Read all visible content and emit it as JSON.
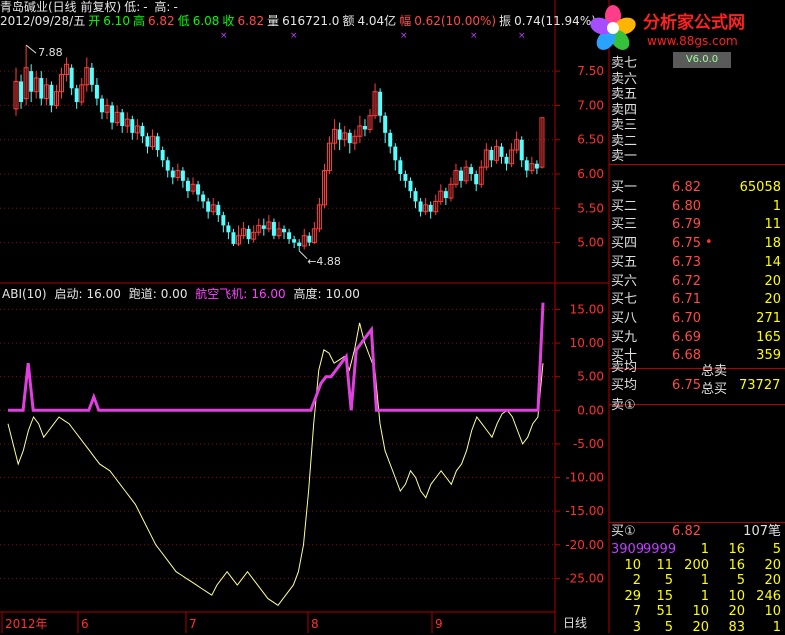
{
  "header": {
    "stock_name": "青岛碱业(日线 前复权)",
    "low_label": "低:",
    "low_val": "-",
    "high_label": "高:",
    "high_val": "-",
    "date_line": "2012/09/28/五",
    "open_label": "开",
    "open_val": "6.10",
    "high2_label": "高",
    "high2_val": "6.82",
    "low2_label": "低",
    "low2_val": "6.08",
    "close_label": "收",
    "close_val": "6.82",
    "volume_label": "量",
    "volume_val": "616721.0",
    "amount_label": "额",
    "amount_val": "4.04亿",
    "change_label": "幅",
    "change_val": "0.62(10.00%)",
    "amp_label": "振",
    "amp_val": "0.74(11.94%)"
  },
  "logo": {
    "text": "分析家公式网",
    "url": "www.88gs.com",
    "version": "V6.0.0"
  },
  "indicator": {
    "name": "ABI(10)",
    "items": [
      {
        "label": "启动:",
        "value": "16.00"
      },
      {
        "label": "跑道:",
        "value": "0.00"
      },
      {
        "label": "航空飞机:",
        "value": "16.00"
      },
      {
        "label": "高度:",
        "value": "10.00"
      }
    ]
  },
  "annotations": {
    "high_mark": "7.88",
    "low_mark": "4.88"
  },
  "x_axis_labels": [
    "2012年",
    "6",
    "7",
    "8",
    "9"
  ],
  "period_label": "日线",
  "order_book": {
    "sell": [
      {
        "label": "卖七",
        "price": "",
        "vol": ""
      },
      {
        "label": "卖六",
        "price": "",
        "vol": ""
      },
      {
        "label": "卖五",
        "price": "",
        "vol": ""
      },
      {
        "label": "卖四",
        "price": "",
        "vol": ""
      },
      {
        "label": "卖三",
        "price": "",
        "vol": ""
      },
      {
        "label": "卖二",
        "price": "",
        "vol": ""
      },
      {
        "label": "卖一",
        "price": "",
        "vol": ""
      }
    ],
    "buy": [
      {
        "label": "买一",
        "price": "6.82",
        "vol": "65058"
      },
      {
        "label": "买二",
        "price": "6.80",
        "vol": "1"
      },
      {
        "label": "买三",
        "price": "6.79",
        "vol": "11"
      },
      {
        "label": "买四",
        "price": "6.75",
        "vol": "18"
      },
      {
        "label": "买五",
        "price": "6.73",
        "vol": "14"
      },
      {
        "label": "买六",
        "price": "6.72",
        "vol": "20"
      },
      {
        "label": "买七",
        "price": "6.71",
        "vol": "20"
      },
      {
        "label": "买八",
        "price": "6.70",
        "vol": "271"
      },
      {
        "label": "买九",
        "price": "6.69",
        "vol": "165"
      },
      {
        "label": "买十",
        "price": "6.68",
        "vol": "359"
      }
    ],
    "sell_avg_label": "卖均",
    "buy_avg_label": "买均",
    "buy_avg_val": "6.75",
    "total_sell_label": "总卖",
    "total_buy_label": "总买",
    "total_buy_val": "73727",
    "sell_circle_label": "卖①",
    "buy_circle_label": "买①",
    "buy_circle_price": "6.82",
    "buy_circle_count": "107笔"
  },
  "queue_rows": [
    [
      "3909",
      "9999",
      "1",
      "16",
      "5"
    ],
    [
      "10",
      "11",
      "200",
      "16",
      "20"
    ],
    [
      "2",
      "5",
      "1",
      "5",
      "20"
    ],
    [
      "29",
      "15",
      "1",
      "10",
      "246"
    ],
    [
      "7",
      "51",
      "10",
      "20",
      "10"
    ],
    [
      "3",
      "5",
      "20",
      "83",
      "1"
    ]
  ],
  "chart_data": [
    {
      "type": "candlestick",
      "title": "",
      "ylim": [
        4.6,
        8.1
      ],
      "y_ticks": [
        5.0,
        5.5,
        6.0,
        6.5,
        7.0,
        7.5
      ],
      "x_ticks": [
        "2012年",
        "6",
        "7",
        "8",
        "9"
      ],
      "annotations": [
        {
          "text": "7.88",
          "at": "max"
        },
        {
          "text": "4.88",
          "at": "min"
        }
      ],
      "candles": [
        [
          6.95,
          7.35,
          7.55,
          6.85
        ],
        [
          7.35,
          7.05,
          7.45,
          6.95
        ],
        [
          7.1,
          7.55,
          7.88,
          7.0
        ],
        [
          7.5,
          7.2,
          7.6,
          7.05
        ],
        [
          7.2,
          7.4,
          7.5,
          7.1
        ],
        [
          7.4,
          7.1,
          7.5,
          7.0
        ],
        [
          7.1,
          7.3,
          7.4,
          7.0
        ],
        [
          7.3,
          7.0,
          7.35,
          6.9
        ],
        [
          7.0,
          7.2,
          7.3,
          6.95
        ],
        [
          7.2,
          7.45,
          7.55,
          7.1
        ],
        [
          7.45,
          7.6,
          7.7,
          7.35
        ],
        [
          7.55,
          7.25,
          7.6,
          7.15
        ],
        [
          7.25,
          7.05,
          7.3,
          6.95
        ],
        [
          7.05,
          7.3,
          7.4,
          7.0
        ],
        [
          7.3,
          7.55,
          7.7,
          7.2
        ],
        [
          7.55,
          7.3,
          7.62,
          7.2
        ],
        [
          7.3,
          7.1,
          7.4,
          7.0
        ],
        [
          7.1,
          6.9,
          7.15,
          6.8
        ],
        [
          6.9,
          7.0,
          7.1,
          6.8
        ],
        [
          7.0,
          6.75,
          7.05,
          6.65
        ],
        [
          6.75,
          6.9,
          7.0,
          6.7
        ],
        [
          6.9,
          6.7,
          6.95,
          6.6
        ],
        [
          6.7,
          6.8,
          6.9,
          6.6
        ],
        [
          6.8,
          6.6,
          6.85,
          6.5
        ],
        [
          6.6,
          6.7,
          6.8,
          6.5
        ],
        [
          6.7,
          6.55,
          6.75,
          6.45
        ],
        [
          6.55,
          6.4,
          6.6,
          6.3
        ],
        [
          6.4,
          6.55,
          6.65,
          6.35
        ],
        [
          6.55,
          6.35,
          6.6,
          6.25
        ],
        [
          6.35,
          6.2,
          6.4,
          6.1
        ],
        [
          6.2,
          6.05,
          6.25,
          5.95
        ],
        [
          6.05,
          5.95,
          6.1,
          5.85
        ],
        [
          5.95,
          6.05,
          6.15,
          5.9
        ],
        [
          6.05,
          5.9,
          6.1,
          5.8
        ],
        [
          5.9,
          5.75,
          5.95,
          5.65
        ],
        [
          5.75,
          5.85,
          5.95,
          5.7
        ],
        [
          5.85,
          5.7,
          5.9,
          5.6
        ],
        [
          5.7,
          5.6,
          5.75,
          5.5
        ],
        [
          5.6,
          5.45,
          5.65,
          5.35
        ],
        [
          5.45,
          5.55,
          5.65,
          5.4
        ],
        [
          5.55,
          5.4,
          5.6,
          5.3
        ],
        [
          5.4,
          5.25,
          5.45,
          5.15
        ],
        [
          5.25,
          5.15,
          5.3,
          5.05
        ],
        [
          5.15,
          4.98,
          5.2,
          4.95
        ],
        [
          4.98,
          5.1,
          5.25,
          4.95
        ],
        [
          5.1,
          5.2,
          5.3,
          5.05
        ],
        [
          5.2,
          5.05,
          5.25,
          4.98
        ],
        [
          5.05,
          5.15,
          5.25,
          5.0
        ],
        [
          5.15,
          5.25,
          5.35,
          5.1
        ],
        [
          5.25,
          5.2,
          5.35,
          5.1
        ],
        [
          5.2,
          5.3,
          5.4,
          5.15
        ],
        [
          5.3,
          5.1,
          5.35,
          5.05
        ],
        [
          5.1,
          5.2,
          5.3,
          5.05
        ],
        [
          5.2,
          5.15,
          5.25,
          5.05
        ],
        [
          5.15,
          5.05,
          5.2,
          4.98
        ],
        [
          5.05,
          5.0,
          5.1,
          4.92
        ],
        [
          5.0,
          4.95,
          5.05,
          4.88
        ],
        [
          4.95,
          5.1,
          5.2,
          4.9
        ],
        [
          5.1,
          5.0,
          5.15,
          4.95
        ],
        [
          5.0,
          5.2,
          5.3,
          4.98
        ],
        [
          5.2,
          5.55,
          5.65,
          5.15
        ],
        [
          5.55,
          6.05,
          6.15,
          5.5
        ],
        [
          6.05,
          6.45,
          6.55,
          6.0
        ],
        [
          6.45,
          6.65,
          6.8,
          6.35
        ],
        [
          6.65,
          6.5,
          6.75,
          6.35
        ],
        [
          6.5,
          6.6,
          6.7,
          6.4
        ],
        [
          6.6,
          6.45,
          6.65,
          6.3
        ],
        [
          6.45,
          6.55,
          6.65,
          6.35
        ],
        [
          6.55,
          6.7,
          6.85,
          6.45
        ],
        [
          6.7,
          6.65,
          6.8,
          6.55
        ],
        [
          6.65,
          6.85,
          6.95,
          6.6
        ],
        [
          6.85,
          7.2,
          7.32,
          6.8
        ],
        [
          7.2,
          6.85,
          7.25,
          6.75
        ],
        [
          6.85,
          6.6,
          6.9,
          6.45
        ],
        [
          6.6,
          6.4,
          6.65,
          6.3
        ],
        [
          6.4,
          6.2,
          6.45,
          6.05
        ],
        [
          6.2,
          6.0,
          6.25,
          5.9
        ],
        [
          6.0,
          5.9,
          6.05,
          5.8
        ],
        [
          5.9,
          5.75,
          5.95,
          5.65
        ],
        [
          5.75,
          5.6,
          5.8,
          5.5
        ],
        [
          5.6,
          5.45,
          5.65,
          5.38
        ],
        [
          5.45,
          5.55,
          5.65,
          5.4
        ],
        [
          5.55,
          5.45,
          5.6,
          5.35
        ],
        [
          5.45,
          5.6,
          5.7,
          5.4
        ],
        [
          5.6,
          5.75,
          5.85,
          5.55
        ],
        [
          5.75,
          5.65,
          5.8,
          5.55
        ],
        [
          5.65,
          5.85,
          5.95,
          5.6
        ],
        [
          5.85,
          6.05,
          6.15,
          5.8
        ],
        [
          6.05,
          5.9,
          6.1,
          5.8
        ],
        [
          5.9,
          6.1,
          6.2,
          5.85
        ],
        [
          6.1,
          6.0,
          6.15,
          5.9
        ],
        [
          6.0,
          5.85,
          6.05,
          5.75
        ],
        [
          5.85,
          6.1,
          6.2,
          5.8
        ],
        [
          6.1,
          6.35,
          6.45,
          6.05
        ],
        [
          6.35,
          6.2,
          6.4,
          6.1
        ],
        [
          6.2,
          6.4,
          6.5,
          6.15
        ],
        [
          6.4,
          6.25,
          6.45,
          6.15
        ],
        [
          6.25,
          6.15,
          6.3,
          6.05
        ],
        [
          6.15,
          6.35,
          6.45,
          6.1
        ],
        [
          6.35,
          6.5,
          6.62,
          6.3
        ],
        [
          6.5,
          6.2,
          6.55,
          6.1
        ],
        [
          6.2,
          6.05,
          6.25,
          5.95
        ],
        [
          6.05,
          6.15,
          6.25,
          6.0
        ],
        [
          6.15,
          6.08,
          6.2,
          6.0
        ],
        [
          6.1,
          6.82,
          6.82,
          6.08
        ]
      ]
    },
    {
      "type": "line",
      "title": "ABI(10)",
      "ylim": [
        -30,
        17
      ],
      "y_ticks": [
        15.0,
        10.0,
        5.0,
        0.0,
        -5.0,
        -10.0,
        -15.0,
        -20.0,
        -25.0
      ],
      "series": [
        {
          "name": "",
          "values": [
            -2,
            -5,
            -8,
            -6,
            -3,
            -1,
            -2,
            -4,
            -3,
            -2,
            -1,
            -1.5,
            -2,
            -3,
            -4,
            -5,
            -6,
            -7,
            -8,
            -8.5,
            -9,
            -10,
            -11,
            -12,
            -13,
            -14,
            -15.5,
            -17,
            -18.5,
            -20,
            -21,
            -22,
            -23,
            -24,
            -24.5,
            -25,
            -25.5,
            -26,
            -26.5,
            -27,
            -27.5,
            -26,
            -25,
            -24,
            -25,
            -26,
            -25,
            -24,
            -25,
            -26,
            -27,
            -28,
            -28.5,
            -29,
            -28,
            -27,
            -26,
            -24,
            -20,
            -12,
            -2,
            6,
            9,
            8.5,
            7,
            7.5,
            8,
            6,
            9,
            13,
            10,
            8,
            6,
            -2,
            -6,
            -8,
            -10,
            -12,
            -11,
            -9,
            -10,
            -12,
            -13,
            -11,
            -10,
            -9,
            -10,
            -11,
            -9,
            -8,
            -6,
            -3,
            -1,
            -2,
            -3,
            -4,
            -2,
            -0.5,
            0,
            -1,
            -3,
            -5,
            -4,
            -2,
            -1,
            7
          ]
        },
        {
          "name": "",
          "values": [
            0,
            0,
            0,
            0,
            7,
            0,
            0,
            0,
            0,
            0,
            0,
            0,
            0,
            0,
            0,
            0,
            0,
            2,
            0,
            0,
            0,
            0,
            0,
            0,
            0,
            0,
            0,
            0,
            0,
            0,
            0,
            0,
            0,
            0,
            0,
            0,
            0,
            0,
            0,
            0,
            0,
            0,
            0,
            0,
            0,
            0,
            0,
            0,
            0,
            0,
            0,
            0,
            0,
            0,
            0,
            0,
            0,
            0,
            0,
            0,
            0,
            2,
            4,
            5,
            5,
            6,
            7,
            8,
            0,
            9,
            10,
            11,
            12,
            0,
            0,
            0,
            0,
            0,
            0,
            0,
            0,
            0,
            0,
            0,
            0,
            0,
            0,
            0,
            0,
            0,
            0,
            0,
            0,
            0,
            0,
            0,
            0,
            0,
            0,
            0,
            0,
            0,
            0,
            0,
            0,
            0,
            16
          ]
        }
      ]
    }
  ]
}
